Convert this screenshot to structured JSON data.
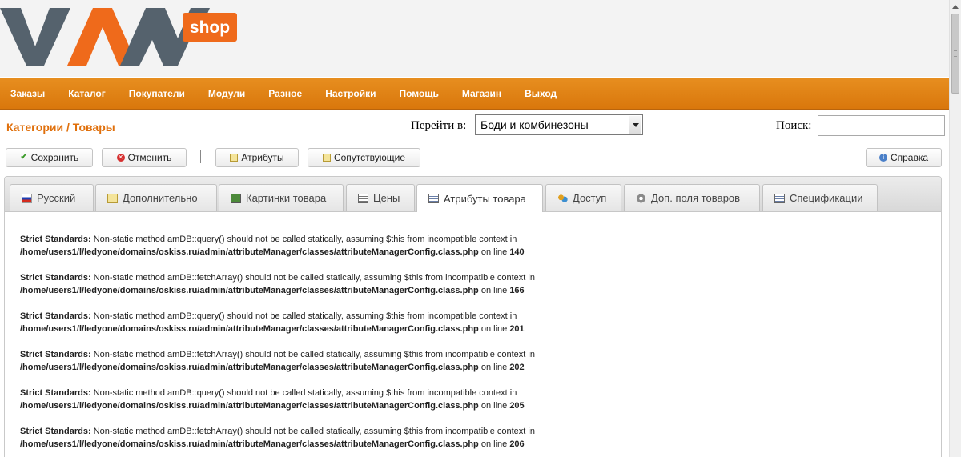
{
  "logo": {
    "text": "VAM",
    "badge": "shop",
    "colors": {
      "gray": "#55626d",
      "orange": "#ef6a1b"
    }
  },
  "nav": [
    "Заказы",
    "Каталог",
    "Покупатели",
    "Модули",
    "Разное",
    "Настройки",
    "Помощь",
    "Магазин",
    "Выход"
  ],
  "title": "Категории / Товары",
  "goto": {
    "label": "Перейти в:",
    "value": "Боди и комбинезоны"
  },
  "search": {
    "label": "Поиск:",
    "value": ""
  },
  "toolbar": {
    "save": "Сохранить",
    "cancel": "Отменить",
    "attributes": "Атрибуты",
    "related": "Сопутствующие",
    "help": "Справка"
  },
  "tabs": [
    {
      "label": "Русский",
      "icon": "flag-ru-icon"
    },
    {
      "label": "Дополнительно",
      "icon": "edit-icon"
    },
    {
      "label": "Картинки товара",
      "icon": "image-icon"
    },
    {
      "label": "Цены",
      "icon": "price-list-icon"
    },
    {
      "label": "Атрибуты товара",
      "icon": "attributes-icon",
      "active": true
    },
    {
      "label": "Доступ",
      "icon": "users-icon"
    },
    {
      "label": "Доп. поля товаров",
      "icon": "gear-icon"
    },
    {
      "label": "Спецификации",
      "icon": "spec-icon"
    }
  ],
  "messages": [
    {
      "prefix": "Strict Standards:",
      "text": " Non-static method amDB::query() should not be called statically, assuming $this from incompatible context in",
      "path": "/home/users1/l/ledyone/domains/oskiss.ru/admin/attributeManager/classes/attributeManagerConfig.class.php",
      "online": " on line ",
      "line": "140"
    },
    {
      "prefix": "Strict Standards:",
      "text": " Non-static method amDB::fetchArray() should not be called statically, assuming $this from incompatible context in",
      "path": "/home/users1/l/ledyone/domains/oskiss.ru/admin/attributeManager/classes/attributeManagerConfig.class.php",
      "online": " on line ",
      "line": "166"
    },
    {
      "prefix": "Strict Standards:",
      "text": " Non-static method amDB::query() should not be called statically, assuming $this from incompatible context in",
      "path": "/home/users1/l/ledyone/domains/oskiss.ru/admin/attributeManager/classes/attributeManagerConfig.class.php",
      "online": " on line ",
      "line": "201"
    },
    {
      "prefix": "Strict Standards:",
      "text": " Non-static method amDB::fetchArray() should not be called statically, assuming $this from incompatible context in",
      "path": "/home/users1/l/ledyone/domains/oskiss.ru/admin/attributeManager/classes/attributeManagerConfig.class.php",
      "online": " on line ",
      "line": "202"
    },
    {
      "prefix": "Strict Standards:",
      "text": " Non-static method amDB::query() should not be called statically, assuming $this from incompatible context in",
      "path": "/home/users1/l/ledyone/domains/oskiss.ru/admin/attributeManager/classes/attributeManagerConfig.class.php",
      "online": " on line ",
      "line": "205"
    },
    {
      "prefix": "Strict Standards:",
      "text": " Non-static method amDB::fetchArray() should not be called statically, assuming $this from incompatible context in",
      "path": "/home/users1/l/ledyone/domains/oskiss.ru/admin/attributeManager/classes/attributeManagerConfig.class.php",
      "online": " on line ",
      "line": "206"
    }
  ]
}
